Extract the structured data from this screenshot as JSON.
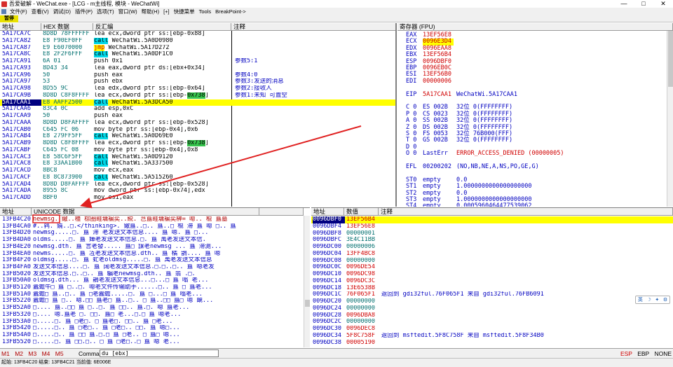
{
  "window": {
    "title": "吾爱破解 - WeChat.exe - [LCG - m主线程, 模块 - WeChatWi]",
    "controls": [
      "—",
      "□",
      "✕"
    ]
  },
  "menu": [
    "文件(F)",
    "查看(V)",
    "调试(D)",
    "插件(P)",
    "选项(T)",
    "窗口(W)",
    "帮助(H)",
    "[+]",
    "快捷菜单",
    "Tools",
    "BreakPoint->"
  ],
  "toolbar": {
    "status": "暂停"
  },
  "disasm": {
    "headers": [
      "地址",
      "HEX 数据",
      "反汇编",
      "注释"
    ],
    "rows": [
      {
        "addr": "5A17CA7C",
        "hex": "8D8D 78FFFFFF",
        "asm": "lea ecx,dword ptr ss:[ebp-0x88]",
        "comment": ""
      },
      {
        "addr": "5A17CA82",
        "hex": "E8 F90EF0FF",
        "asm": "call WeChatWi.5A0D0980",
        "comment": ""
      },
      {
        "addr": "5A17CA87",
        "hex": "E9 E6070000",
        "asm": "jmp WeChatWi.5A17D272",
        "comment": ""
      },
      {
        "addr": "5A17CA8C",
        "hex": "E8 2F2F6FFF",
        "asm": "call WeChatWi.5A0DF1C0",
        "comment": ""
      },
      {
        "addr": "5A17CA91",
        "hex": "6A 01",
        "asm": "push 0x1",
        "comment": "参数5:1"
      },
      {
        "addr": "5A17CA93",
        "hex": "8D43 34",
        "asm": "lea eax,dword ptr ds:[ebx+0x34]",
        "comment": ""
      },
      {
        "addr": "5A17CA96",
        "hex": "50",
        "asm": "push eax",
        "comment": "参数4:0"
      },
      {
        "addr": "5A17CA97",
        "hex": "53",
        "asm": "push ebx",
        "comment": "参数3:发送的消息"
      },
      {
        "addr": "5A17CA98",
        "hex": "8D55 9C",
        "asm": "lea edx,dword ptr ss:[ebp-0x64]",
        "comment": "参数2:接收人"
      },
      {
        "addr": "5A17CA9B",
        "hex": "8D8D C8F8FFFF",
        "asm": "lea ecx,dword ptr ss:[ebp-0x738]",
        "comment": "参数1:未知 可置空"
      },
      {
        "addr": "5A17CAA1",
        "hex": "E8 AAFF2500",
        "asm": "call WeChatWi.5A3DCA50",
        "comment": ""
      },
      {
        "addr": "5A17CAA6",
        "hex": "83C4 0C",
        "asm": "add esp,0xC",
        "comment": ""
      },
      {
        "addr": "5A17CAA9",
        "hex": "50",
        "asm": "push eax",
        "comment": ""
      },
      {
        "addr": "5A17CAAA",
        "hex": "8D8D D8FAFFFF",
        "asm": "lea ecx,dword ptr ss:[ebp-0x528]",
        "comment": ""
      },
      {
        "addr": "5A17CAB0",
        "hex": "C645 FC 06",
        "asm": "mov byte ptr ss:[ebp-0x4],0x6",
        "comment": ""
      },
      {
        "addr": "5A17CAB4",
        "hex": "E8 279FF5FF",
        "asm": "call WeChatWi.5A0D69E0",
        "comment": ""
      },
      {
        "addr": "5A17CAB9",
        "hex": "8D8D C8F8FFFF",
        "asm": "lea ecx,dword ptr ss:[ebp-0x738]",
        "comment": ""
      },
      {
        "addr": "5A17CABF",
        "hex": "C645 FC 08",
        "asm": "mov byte ptr ss:[ebp-0x4],0x8",
        "comment": ""
      },
      {
        "addr": "5A17CAC3",
        "hex": "E8 58C6F5FF",
        "asm": "call WeChatWi.5A0D9120",
        "comment": ""
      },
      {
        "addr": "5A17CAC8",
        "hex": "E8 33AA1B00",
        "asm": "call WeChatWi.5A337500",
        "comment": ""
      },
      {
        "addr": "5A17CACD",
        "hex": "8BC8",
        "asm": "mov ecx,eax",
        "comment": ""
      },
      {
        "addr": "5A17CACF",
        "hex": "E8 8C873900",
        "asm": "call WeChatWi.5A515260",
        "comment": ""
      },
      {
        "addr": "5A17CAD4",
        "hex": "8D8D D8FAFFFF",
        "asm": "lea ecx,dword ptr ss:[ebp-0x528]",
        "comment": ""
      },
      {
        "addr": "5A17CADA",
        "hex": "8955 8C",
        "asm": "mov dword ptr ss:[ebp-0x74],edx",
        "comment": ""
      },
      {
        "addr": "5A17CADD",
        "hex": "8BF0",
        "asm": "mov esi,eax",
        "comment": ""
      }
    ]
  },
  "registers": {
    "header": "寄存器 (FPU)",
    "lines": [
      {
        "name": "EAX",
        "value": "13EF56E8",
        "rest": ""
      },
      {
        "name": "ECX",
        "value": "0096E3D4",
        "rest": ""
      },
      {
        "name": "EDX",
        "value": "0096EAA8",
        "rest": ""
      },
      {
        "name": "EBX",
        "value": "13EF56B4",
        "rest": ""
      },
      {
        "name": "ESP",
        "value": "0096DBF0",
        "rest": ""
      },
      {
        "name": "EBP",
        "value": "0096EB0C",
        "rest": ""
      },
      {
        "name": "ESI",
        "value": "13EF56B0",
        "rest": ""
      },
      {
        "name": "EDI",
        "value": "00000006",
        "rest": ""
      },
      {
        "name": "",
        "value": "",
        "rest": ""
      },
      {
        "name": "EIP",
        "value": "5A17CAA1",
        "rest": "WeChatWi.5A17CAA1"
      },
      {
        "name": "",
        "value": "",
        "rest": ""
      },
      {
        "name": "C 0",
        "value": "ES 002B",
        "rest": "32位 0(FFFFFFFF)"
      },
      {
        "name": "P 0",
        "value": "CS 0023",
        "rest": "32位 0(FFFFFFFF)"
      },
      {
        "name": "A 0",
        "value": "SS 002B",
        "rest": "32位 0(FFFFFFFF)"
      },
      {
        "name": "Z 0",
        "value": "DS 002B",
        "rest": "32位 0(FFFFFFFF)"
      },
      {
        "name": "S 0",
        "value": "FS 0053",
        "rest": "32位 76B000(FFF)"
      },
      {
        "name": "T 0",
        "value": "GS 002B",
        "rest": "32位 0(FFFFFFFF)"
      },
      {
        "name": "D 0",
        "value": "",
        "rest": ""
      },
      {
        "name": "O 0",
        "value": "LastErr",
        "rest": "ERROR_ACCESS_DENIED (00000005)"
      },
      {
        "name": "",
        "value": "",
        "rest": ""
      },
      {
        "name": "EFL",
        "value": "00200202",
        "rest": "(NO,NB,NE,A,NS,PO,GE,G)"
      },
      {
        "name": "",
        "value": "",
        "rest": ""
      },
      {
        "name": "ST0",
        "value": "empty",
        "rest": "0.0"
      },
      {
        "name": "ST1",
        "value": "empty",
        "rest": "1.0000000000000000000"
      },
      {
        "name": "ST2",
        "value": "empty",
        "rest": "0.0"
      },
      {
        "name": "ST3",
        "value": "empty",
        "rest": "1.0000000000000000000"
      },
      {
        "name": "ST4",
        "value": "empty",
        "rest": "0.0005960464477539062"
      }
    ]
  },
  "dump": {
    "headers": [
      "地址",
      "UNICODE 数据"
    ],
    "rows": [
      {
        "addr": "13FB4C20",
        "text": "newmsg.  鏾..橿 棕圈畦墉褊奕..綐. 芑簋畦墉褊奕榊= 嗯.. 棍 簋墓"
      },
      {
        "addr": "13FB4CA0",
        "text": "#..鹑. 鐃..□.</thinking>. 鏾簋..□.. 簋..□ 棍 滞 簋 嗯 □.. 簋"
      },
      {
        "addr": "13FB4D20",
        "text": "newmsg.....□. 簋 滞 老发送文本信息.... 簋 嗯. 簋 □..."
      },
      {
        "addr": "13FB4DA0",
        "text": "oldms.....□. 簋 嬅老发送文本信息.□. 簋 萬老发送文本信."
      },
      {
        "addr": "13FB4E20",
        "text": "newmsg.dth. 簋 言老發..... 簋□ 謀老newmsg ... 簋 滞測..."
      },
      {
        "addr": "13FB4EA0",
        "text": "newms.....□. 簋 冱老发送文本信息.dth.. 簋 橘 鶕.... 簋 嗯"
      },
      {
        "addr": "13FB4F20",
        "text": "oldmsg.....□. 簋 虻老oldmsg.....□. 簋 萬老发送文本信息"
      },
      {
        "addr": "13FB4FA0",
        "text": "发送文本信息....□. 簋 阔老发送文本信息.□.□..□.. 簋 嗯老发"
      },
      {
        "addr": "13FB5020",
        "text": "发送文本信息.□..□.. 簋 騙老newmsg.dth.. 簋 翡 .□."
      },
      {
        "addr": "13FB50A0",
        "text": "oldmsg.dth... 簋 鵑老发送文本信息...□...□ 簋 嗡 老..."
      },
      {
        "addr": "13FB5120",
        "text": "蠹蟾牛□ 簋 □..□. 嗯老文件传输助手......□.. 簋 □ 簋老..."
      },
      {
        "addr": "13FB51A0",
        "text": "蠹蟾□ 簋..□.. 簋 □老蠹蟾.....□. 簋 □...□ 簋 嗡老..."
      },
      {
        "addr": "13FB5220",
        "text": "蠹蟾□ 簋 □.. 嗯.□□ 簋老□ 簋..□.. □ 簋..□□ 簋□ 嗯 靦..."
      },
      {
        "addr": "13FB52A0",
        "text": "□.... 簋..□□ 簋 □..□. 簋 □□.. 簋.□. 嗯 簋老..."
      },
      {
        "addr": "13FB5320",
        "text": "□.... 嗯.簋老 □. □□. 簋□ 老...□.□ 簋 嗯老..."
      },
      {
        "addr": "13FB53A0",
        "text": "□.....□. 簋 □老□. □ 簋老□. □□.. 簋 □老..."
      },
      {
        "addr": "13FB5420",
        "text": "□.....□.. 簋 □老□.. 簋 □老□.. □□. 簋 嗯□..."
      },
      {
        "addr": "13FB54A0",
        "text": "□.....□.. 簋 □□ 簋.□.□ 簋 □老.. □ 簋□ 嗯..."
      },
      {
        "addr": "13FB5520",
        "text": "□.....□. 簋 □□.□.. □ 簋 □老□..□ 簋 嗯 老..."
      }
    ]
  },
  "stack": {
    "headers": [
      "地址",
      "数值",
      "注释"
    ],
    "rows": [
      {
        "addr": "0096DBF0",
        "value": "13EF56B4",
        "comment": ""
      },
      {
        "addr": "0096DBF4",
        "value": "13EF56E8",
        "comment": ""
      },
      {
        "addr": "0096DBF8",
        "value": "00000001",
        "comment": ""
      },
      {
        "addr": "0096DBFC",
        "value": "3E4C11BB",
        "comment": ""
      },
      {
        "addr": "0096DC00",
        "value": "00000006",
        "comment": ""
      },
      {
        "addr": "0096DC04",
        "value": "13FF4BC8",
        "comment": ""
      },
      {
        "addr": "0096DC08",
        "value": "00000000",
        "comment": ""
      },
      {
        "addr": "0096DC0C",
        "value": "0096DE54",
        "comment": ""
      },
      {
        "addr": "0096DC10",
        "value": "0096DC98",
        "comment": ""
      },
      {
        "addr": "0096DC14",
        "value": "0096DC3C",
        "comment": ""
      },
      {
        "addr": "0096DC18",
        "value": "13E6538B",
        "comment": ""
      },
      {
        "addr": "0096DC1C",
        "value": "76F065F1",
        "comment": "返回到 gdi32ful.76F065F1 来自 gdi32ful.76FB6091"
      },
      {
        "addr": "0096DC20",
        "value": "00000000",
        "comment": ""
      },
      {
        "addr": "0096DC24",
        "value": "00000000",
        "comment": ""
      },
      {
        "addr": "0096DC28",
        "value": "0096DBA8",
        "comment": ""
      },
      {
        "addr": "0096DC2C",
        "value": "00000000",
        "comment": ""
      },
      {
        "addr": "0096DC30",
        "value": "0096DEC8",
        "comment": ""
      },
      {
        "addr": "0096DC34",
        "value": "5F8C758F",
        "comment": "返回到 msftedit.5F8C758F 来自 msftedit.5F8F34B0"
      },
      {
        "addr": "0096DC38",
        "value": "00005190",
        "comment": ""
      }
    ]
  },
  "command": {
    "tabs": [
      "M1",
      "M2",
      "M3",
      "M4",
      "M5"
    ],
    "label": "Command:",
    "value": "du [ebx]",
    "right": [
      "ESP",
      "EBP",
      "NONE"
    ]
  },
  "status": "起始: 13FB4C20 结束: 13FB4C21 当前值: 6E006E",
  "ime": [
    "英",
    "☽",
    "✦",
    "⚙"
  ]
}
